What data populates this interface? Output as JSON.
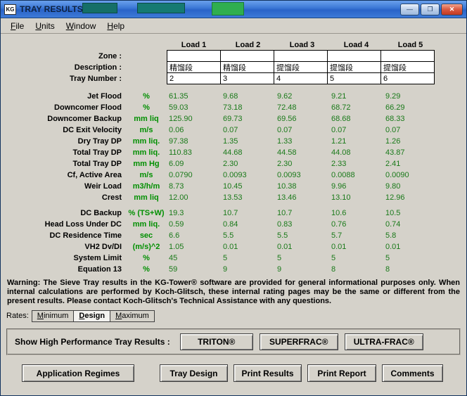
{
  "window": {
    "icon_text": "KG",
    "title": "TRAY RESULTS",
    "controls": [
      {
        "name": "minimize",
        "glyph": "—"
      },
      {
        "name": "maximize",
        "glyph": "❐"
      },
      {
        "name": "close",
        "glyph": "✕"
      }
    ]
  },
  "menu": {
    "items": [
      "File",
      "Units",
      "Window",
      "Help"
    ]
  },
  "table": {
    "load_headers": [
      "Load 1",
      "Load 2",
      "Load 3",
      "Load 4",
      "Load 5"
    ],
    "info_rows": [
      {
        "label": "Zone :",
        "values": [
          "",
          "",
          "",
          "",
          ""
        ]
      },
      {
        "label": "Description :",
        "values": [
          "精馏段",
          "精馏段",
          "提馏段",
          "提馏段",
          "提馏段"
        ]
      },
      {
        "label": "Tray Number :",
        "values": [
          "2",
          "3",
          "4",
          "5",
          "6"
        ]
      }
    ],
    "section1": [
      {
        "label": "Jet Flood",
        "unit": "%",
        "values": [
          "61.35",
          "9.68",
          "9.62",
          "9.21",
          "9.29"
        ]
      },
      {
        "label": "Downcomer Flood",
        "unit": "%",
        "values": [
          "59.03",
          "73.18",
          "72.48",
          "68.72",
          "66.29"
        ]
      },
      {
        "label": "Downcomer Backup",
        "unit": "mm liq",
        "values": [
          "125.90",
          "69.73",
          "69.56",
          "68.68",
          "68.33"
        ]
      },
      {
        "label": "DC Exit Velocity",
        "unit": "m/s",
        "values": [
          "0.06",
          "0.07",
          "0.07",
          "0.07",
          "0.07"
        ]
      },
      {
        "label": "Dry Tray DP",
        "unit": "mm liq.",
        "values": [
          "97.38",
          "1.35",
          "1.33",
          "1.21",
          "1.26"
        ]
      },
      {
        "label": "Total Tray DP",
        "unit": "mm liq.",
        "values": [
          "110.83",
          "44.68",
          "44.58",
          "44.08",
          "43.87"
        ]
      },
      {
        "label": "Total Tray DP",
        "unit": "mm Hg",
        "values": [
          "6.09",
          "2.30",
          "2.30",
          "2.33",
          "2.41"
        ]
      },
      {
        "label": "Cf, Active Area",
        "unit": "m/s",
        "values": [
          "0.0790",
          "0.0093",
          "0.0093",
          "0.0088",
          "0.0090"
        ]
      },
      {
        "label": "Weir Load",
        "unit": "m3/h/m",
        "values": [
          "8.73",
          "10.45",
          "10.38",
          "9.96",
          "9.80"
        ]
      },
      {
        "label": "Crest",
        "unit": "mm liq",
        "values": [
          "12.00",
          "13.53",
          "13.46",
          "13.10",
          "12.96"
        ]
      }
    ],
    "section2": [
      {
        "label": "DC Backup",
        "unit": "% (TS+W)",
        "values": [
          "19.3",
          "10.7",
          "10.7",
          "10.6",
          "10.5"
        ]
      },
      {
        "label": "Head Loss Under DC",
        "unit": "mm liq.",
        "values": [
          "0.59",
          "0.84",
          "0.83",
          "0.76",
          "0.74"
        ]
      },
      {
        "label": "DC Residence Time",
        "unit": "sec",
        "values": [
          "6.6",
          "5.5",
          "5.5",
          "5.7",
          "5.8"
        ]
      },
      {
        "label": "VH2 Dv/DI",
        "unit": "(m/s)^2",
        "values": [
          "1.05",
          "0.01",
          "0.01",
          "0.01",
          "0.01"
        ]
      },
      {
        "label": "System Limit",
        "unit": "%",
        "values": [
          "45",
          "5",
          "5",
          "5",
          "5"
        ]
      },
      {
        "label": "Equation 13",
        "unit": "%",
        "values": [
          "59",
          "9",
          "9",
          "8",
          "8"
        ]
      }
    ]
  },
  "warning": "Warning: The Sieve Tray results in the KG-Tower® software are provided for general informational purposes only. When internal calculations are performed by Koch-Glitsch, these internal rating pages may be the same or different from the present results. Please contact Koch-Glitsch's Technical Assistance with any questions.",
  "rates": {
    "label": "Rates:",
    "tabs": [
      "Minimum",
      "Design",
      "Maximum"
    ],
    "selected": "Design"
  },
  "high_performance": {
    "label": "Show High Performance Tray Results :",
    "buttons": [
      "TRITON®",
      "SUPERFRAC®",
      "ULTRA-FRAC®"
    ]
  },
  "bottom_buttons": [
    "Application Regimes",
    "Tray Design",
    "Print Results",
    "Print Report",
    "Comments"
  ],
  "colors": {
    "face": "#d5d2ca",
    "titlebar_blue": "#2a64c8",
    "unit_green": "#008f00",
    "value_green": "#1a7a1a"
  }
}
